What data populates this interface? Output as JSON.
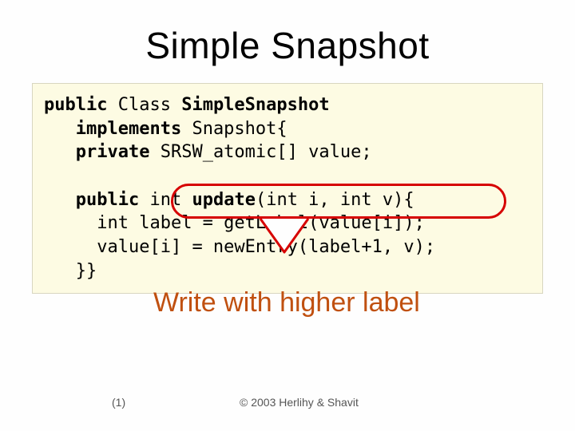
{
  "title": "Simple Snapshot",
  "code": {
    "l1a": "public",
    "l1b": " Class ",
    "l1c": "SimpleSnapshot",
    "l2a": "implements",
    "l2b": " Snapshot{",
    "l3a": "private",
    "l3b": " SRSW_atomic[] value;",
    "blank": "",
    "l4a": "public",
    "l4b": " int ",
    "l4c": "update",
    "l4d": "(int i, int v){",
    "l5": "int label = getLabel(value[i]);",
    "l6": "value[i] = newEntry(label+1, v);",
    "l7": "}}"
  },
  "caption": "Write with higher label",
  "slide_number": "(1)",
  "copyright": "© 2003 Herlihy & Shavit"
}
